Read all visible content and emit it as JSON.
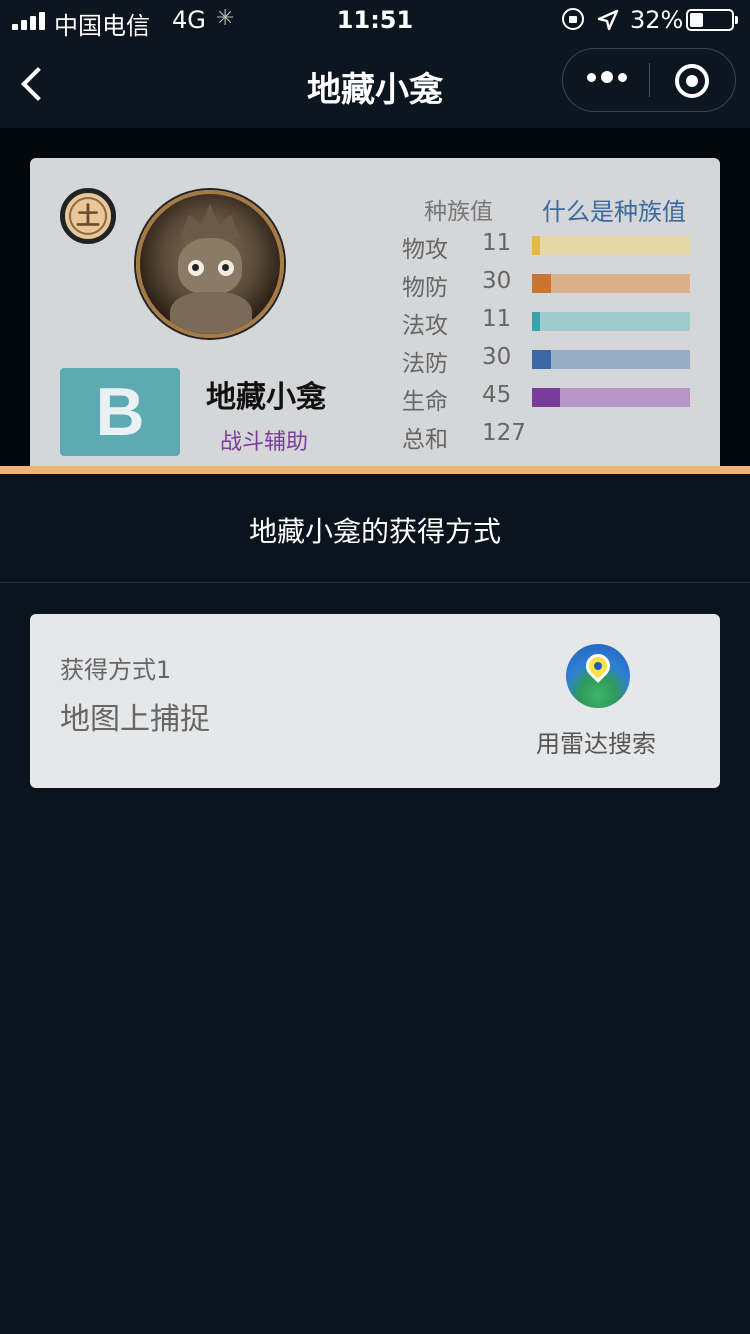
{
  "status_bar": {
    "carrier": "中国电信",
    "network": "4G",
    "time": "11:51",
    "battery_percent": "32%",
    "battery_level": 0.32
  },
  "nav": {
    "title": "地藏小龛",
    "more_icon": "more-dots-icon",
    "close_icon": "target-close-icon",
    "back_icon": "chevron-left-icon"
  },
  "pet_card": {
    "element": "土",
    "rank": "B",
    "name": "地藏小龛",
    "role": "战斗辅助",
    "stats_header": "种族值",
    "stats_help_link": "什么是种族值",
    "stats": [
      {
        "label": "物攻",
        "value": "11",
        "fraction": 0.05,
        "color": "#e6b84a",
        "track": "#e7d8a8"
      },
      {
        "label": "物防",
        "value": "30",
        "fraction": 0.12,
        "color": "#c9742f",
        "track": "#dcb08a"
      },
      {
        "label": "法攻",
        "value": "11",
        "fraction": 0.05,
        "color": "#3aa5a8",
        "track": "#9fcbcc"
      },
      {
        "label": "法防",
        "value": "30",
        "fraction": 0.12,
        "color": "#3c68a8",
        "track": "#98aec8"
      },
      {
        "label": "生命",
        "value": "45",
        "fraction": 0.18,
        "color": "#7a3c9a",
        "track": "#b796c6"
      }
    ],
    "total_label": "总和",
    "total_value": "127"
  },
  "colors": {
    "accent_line": "#f0b472",
    "background": "#0b131d",
    "rank_box": "#5eaab2"
  },
  "obtain": {
    "title": "地藏小龛的获得方式",
    "methods": [
      {
        "index_label": "获得方式1",
        "description": "地图上捕捉",
        "action_label": "用雷达搜索",
        "action_icon": "radar-map-pin-icon"
      }
    ]
  }
}
